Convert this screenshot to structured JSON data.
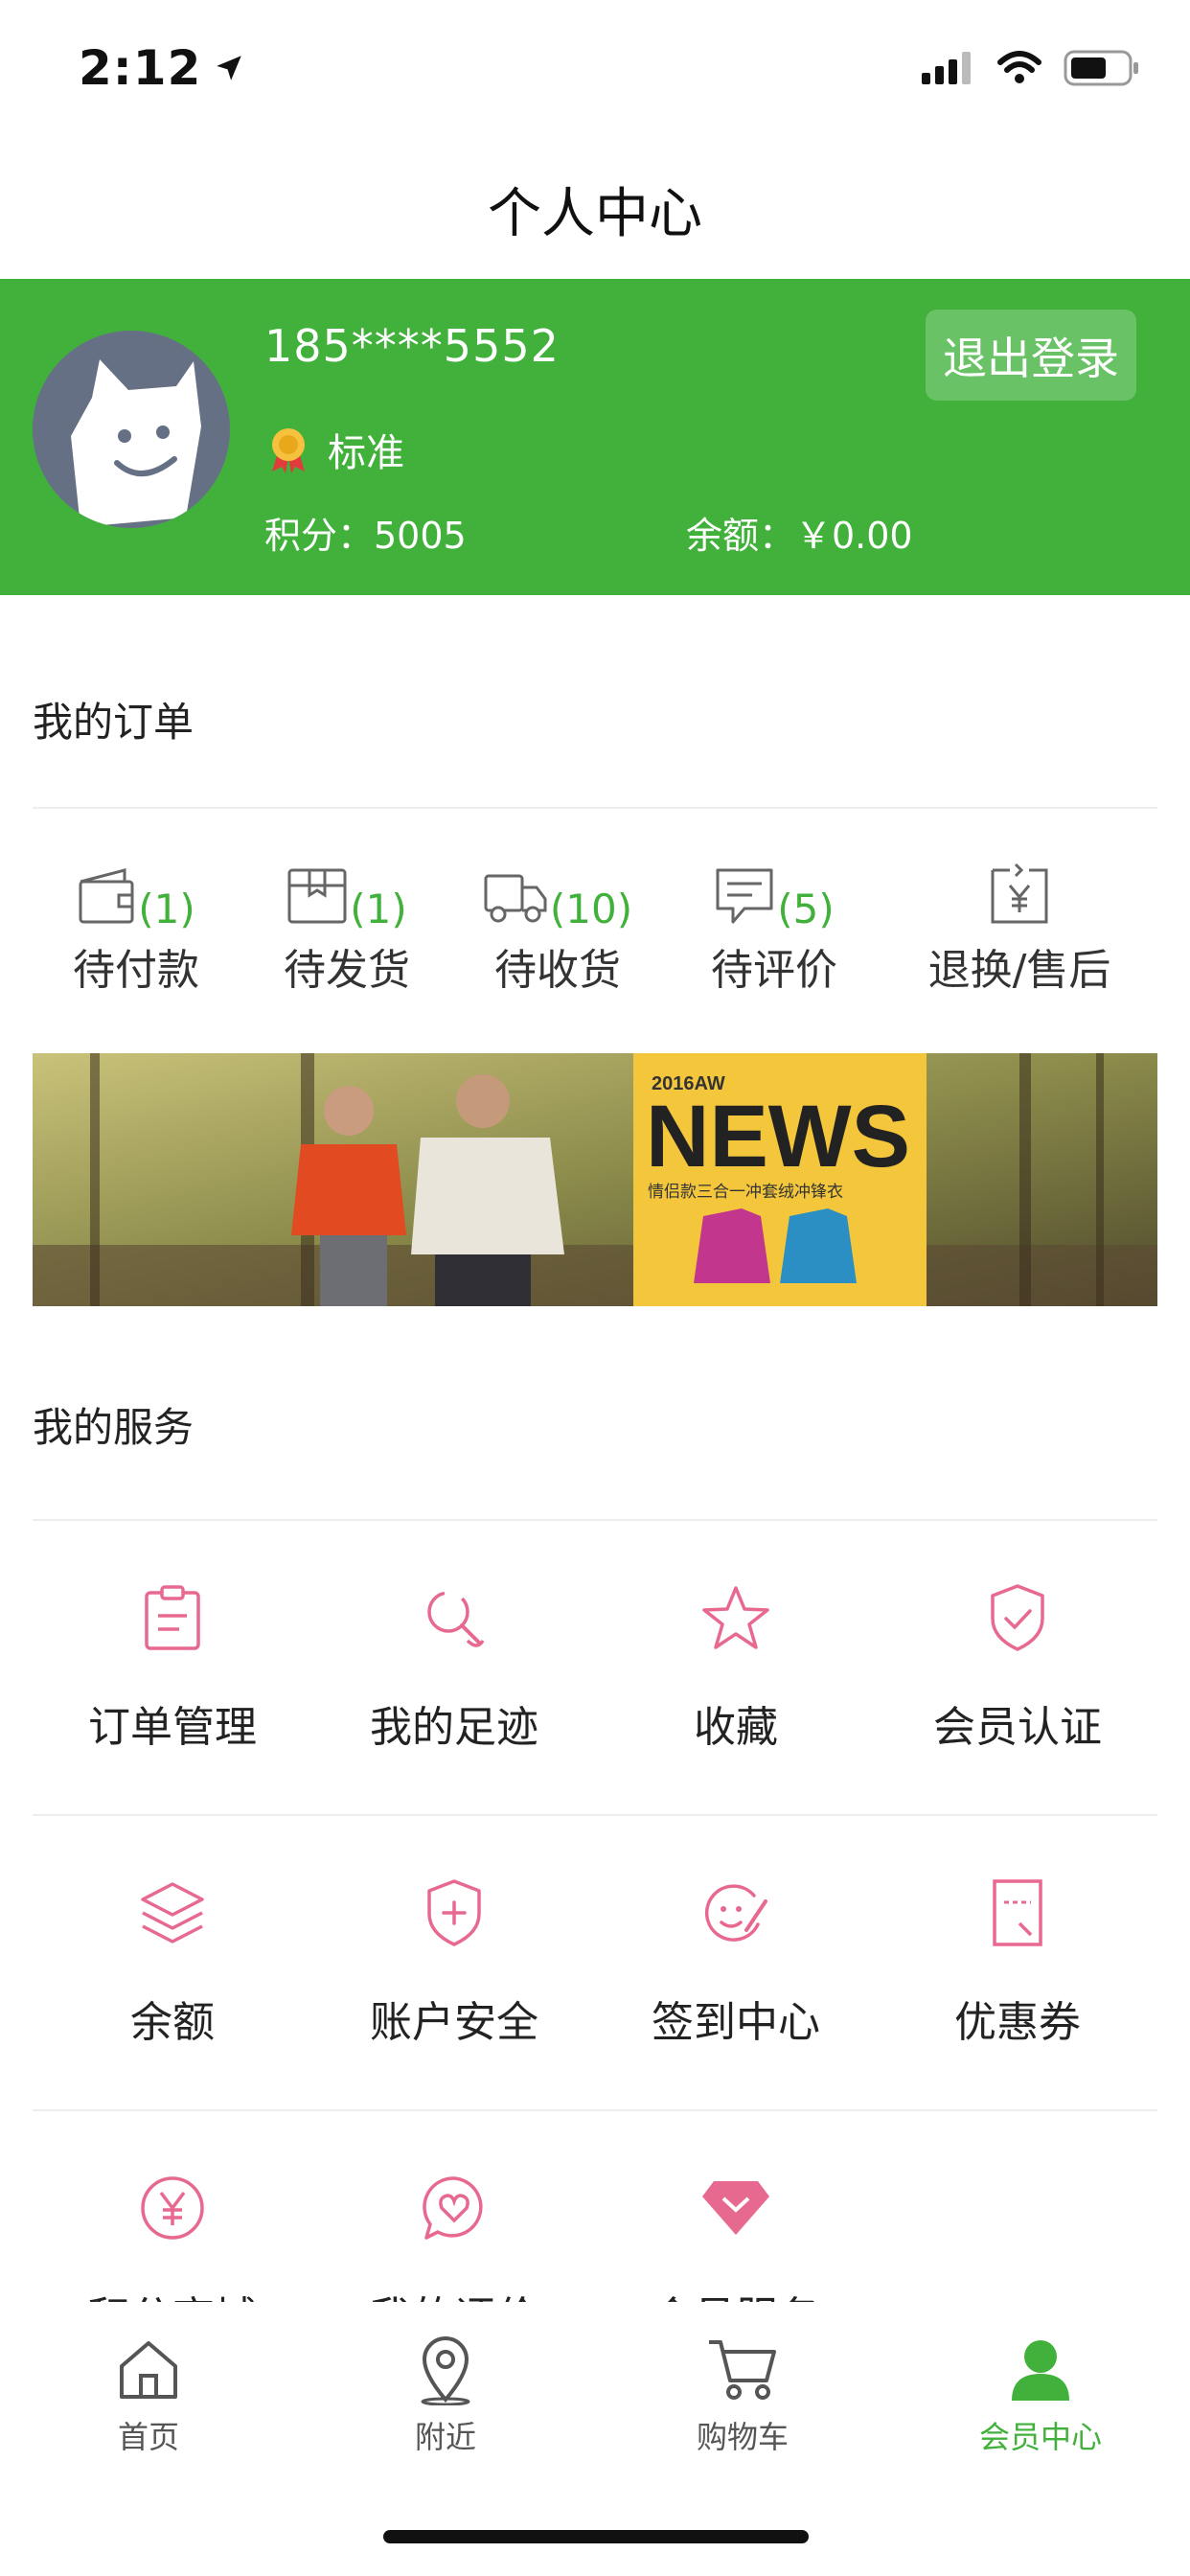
{
  "status_bar": {
    "time": "2:12"
  },
  "nav": {
    "title": "个人中心"
  },
  "profile": {
    "phone": "185****5552",
    "level": "标准",
    "points_text": "积分：5005",
    "balance_text": "余额：￥0.00",
    "logout_label": "退出登录"
  },
  "orders": {
    "title": "我的订单",
    "items": [
      {
        "label": "待付款",
        "count": "(1)",
        "icon": "wallet-icon"
      },
      {
        "label": "待发货",
        "count": "(1)",
        "icon": "box-icon"
      },
      {
        "label": "待收货",
        "count": "(10)",
        "icon": "truck-icon"
      },
      {
        "label": "待评价",
        "count": "(5)",
        "icon": "comment-icon"
      },
      {
        "label": "退换/售后",
        "count": "",
        "icon": "yen-refund-icon"
      }
    ]
  },
  "promo": {
    "tag": "2016AW",
    "headline": "NEWS",
    "subline": "情侣款三合一冲套绒冲锋衣"
  },
  "services": {
    "title": "我的服务",
    "items": [
      {
        "label": "订单管理",
        "icon": "clipboard-icon"
      },
      {
        "label": "我的足迹",
        "icon": "footprint-search-icon"
      },
      {
        "label": "收藏",
        "icon": "star-icon"
      },
      {
        "label": "会员认证",
        "icon": "shield-check-icon"
      },
      {
        "label": "余额",
        "icon": "layers-icon"
      },
      {
        "label": "账户安全",
        "icon": "shield-plus-icon"
      },
      {
        "label": "签到中心",
        "icon": "sign-in-icon"
      },
      {
        "label": "优惠券",
        "icon": "coupon-icon"
      },
      {
        "label": "积分商城",
        "icon": "yen-circle-icon"
      },
      {
        "label": "我的评价",
        "icon": "heart-chat-icon"
      },
      {
        "label": "会员服务",
        "icon": "diamond-icon"
      }
    ]
  },
  "tabbar": {
    "items": [
      {
        "label": "首页",
        "icon": "home-icon"
      },
      {
        "label": "附近",
        "icon": "location-pin-icon"
      },
      {
        "label": "购物车",
        "icon": "cart-icon"
      },
      {
        "label": "会员中心",
        "icon": "user-icon"
      }
    ],
    "active_index": 3
  },
  "colors": {
    "brand_green": "#41b13b",
    "service_pink": "#e8698f"
  }
}
